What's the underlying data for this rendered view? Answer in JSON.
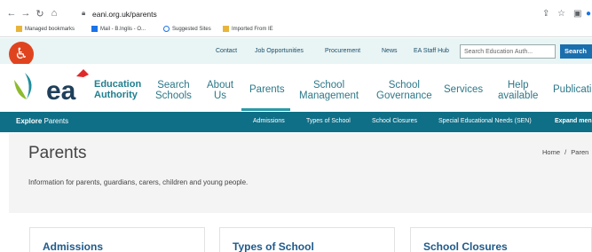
{
  "browser": {
    "url": "eani.org.uk/parents",
    "bookmarks": [
      {
        "label": "Managed bookmarks",
        "color": "#e8b43a"
      },
      {
        "label": "Mail - B.Inglis - O...",
        "color": "#1a73e8"
      },
      {
        "label": "Suggested Sites",
        "color": "#1a73e8"
      },
      {
        "label": "Imported From IE",
        "color": "#e8b43a"
      }
    ]
  },
  "utility": {
    "links": [
      "Contact",
      "Job Opportunities",
      "Procurement",
      "News",
      "EA Staff Hub"
    ],
    "search_placeholder": "Search Education Auth...",
    "search_button": "Search"
  },
  "logo": {
    "wordmark": "ea",
    "line1": "Education",
    "line2": "Authority",
    "colors": {
      "green": "#8dbb2e",
      "teal": "#1f8e9e",
      "red": "#e02a2a",
      "text": "#1f7f8f"
    }
  },
  "main_nav": [
    {
      "label": "Search Schools",
      "l1": "Search",
      "l2": "Schools"
    },
    {
      "label": "About Us",
      "l1": "About",
      "l2": "Us"
    },
    {
      "label": "Parents",
      "l1": "Parents",
      "l2": ""
    },
    {
      "label": "School Management",
      "l1": "School",
      "l2": "Management"
    },
    {
      "label": "School Governance",
      "l1": "School",
      "l2": "Governance"
    },
    {
      "label": "Services",
      "l1": "Services",
      "l2": ""
    },
    {
      "label": "Help available",
      "l1": "Help",
      "l2": "available"
    },
    {
      "label": "Publications",
      "l1": "Publicati",
      "l2": ""
    }
  ],
  "section_nav": {
    "explore_bold": "Explore",
    "explore_rest": " Parents",
    "items": [
      "Admissions",
      "Types of School",
      "School Closures",
      "Special Educational Needs (SEN)",
      "Expand men"
    ]
  },
  "page": {
    "title": "Parents",
    "description": "Information for parents, guardians, carers, children and young people.",
    "breadcrumb_home": "Home",
    "breadcrumb_sep": "/",
    "breadcrumb_current": "Paren"
  },
  "cards": [
    "Admissions",
    "Types of School",
    "School Closures"
  ]
}
